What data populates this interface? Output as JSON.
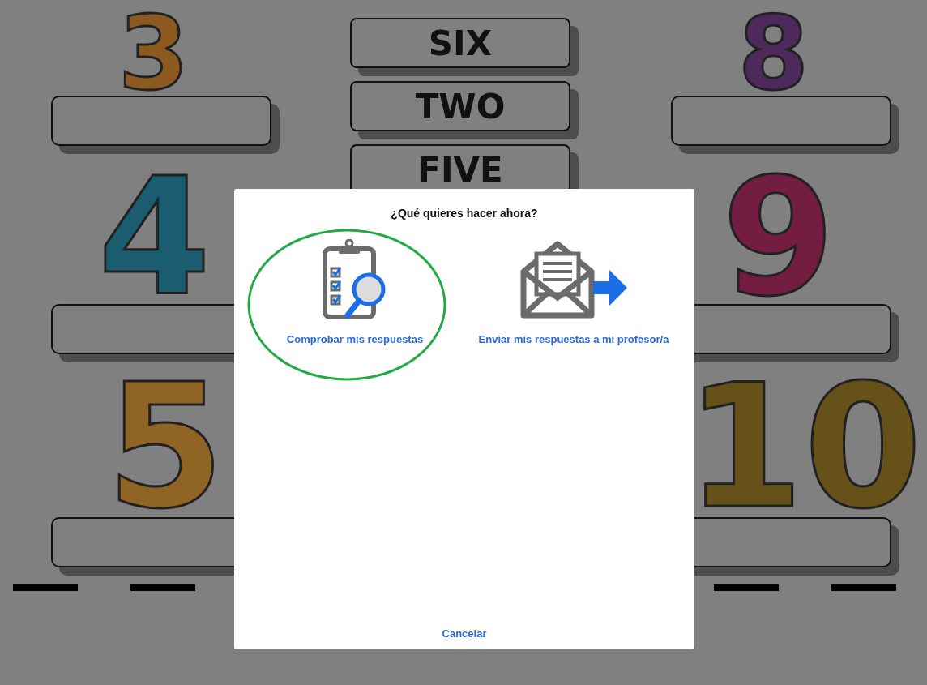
{
  "worksheet": {
    "numbers": [
      {
        "digit": "3",
        "color": "#8c5a20"
      },
      {
        "digit": "4",
        "color": "#1a5c70"
      },
      {
        "digit": "5",
        "color": "#8f6425"
      },
      {
        "digit": "8",
        "color": "#4e2a5c"
      },
      {
        "digit": "9",
        "color": "#731d40"
      },
      {
        "digit": "10",
        "color": "#665218"
      }
    ],
    "word_cards": [
      "SIX",
      "TWO",
      "FIVE"
    ]
  },
  "dialog": {
    "title": "¿Qué quieres hacer ahora?",
    "options": [
      {
        "kind": "check",
        "label": "Comprobar mis respuestas",
        "highlighted": true
      },
      {
        "kind": "send",
        "label": "Enviar mis respuestas a mi profesor/a",
        "highlighted": false
      }
    ],
    "cancel": "Cancelar"
  }
}
